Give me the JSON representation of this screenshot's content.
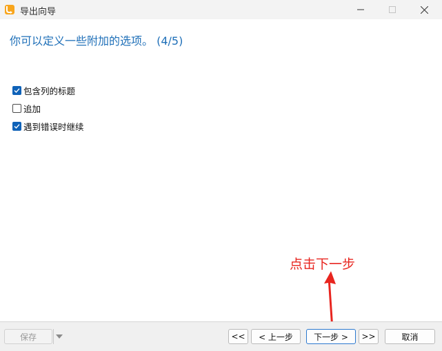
{
  "window": {
    "title": "导出向导"
  },
  "heading": "你可以定义一些附加的选项。 (4/5)",
  "options": [
    {
      "label": "包含列的标题",
      "checked": true
    },
    {
      "label": "追加",
      "checked": false
    },
    {
      "label": "遇到错误时继续",
      "checked": true
    }
  ],
  "annotation": {
    "text": "点击下一步",
    "color": "#e8251f"
  },
  "buttons": {
    "save": "保存",
    "first": "<<",
    "prev": "< 上一步",
    "next": "下一步 >",
    "last": ">>",
    "cancel": "取消"
  },
  "colors": {
    "accent": "#1e6fb8",
    "checkbox": "#0f62b8"
  }
}
